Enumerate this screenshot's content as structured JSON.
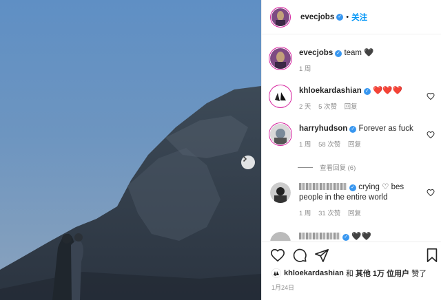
{
  "post": {
    "author": "evecjobs",
    "dot": "•",
    "follow_label": "关注",
    "caption": "team 🖤",
    "caption_time": "1 周"
  },
  "comments": [
    {
      "user": "khloekardashian",
      "text": "❤️❤️❤️",
      "time": "2 天",
      "likes": "5 次赞",
      "reply": "回复"
    },
    {
      "user": "harryhudson",
      "text": "Forever as fuck",
      "time": "1 周",
      "likes": "58 次赞",
      "reply": "回复"
    },
    {
      "user_hidden": "",
      "text_a": "crying ♡ bes",
      "text_b": "people in the entire world",
      "time": "1 周",
      "likes": "31 次赞",
      "reply": "回复"
    },
    {
      "text": "🖤🖤"
    }
  ],
  "view_replies": "查看回复 (6)",
  "likes_summary": {
    "user": "khloekardashian",
    "and": "和",
    "others": "其他 1万 位用户",
    "liked": "赞了"
  },
  "date": "1月24日",
  "icons": [
    "heart-icon",
    "comment-icon",
    "share-icon",
    "bookmark-icon",
    "next-arrow-icon",
    "verified-icon"
  ],
  "colors": {
    "verified": "#3897f0",
    "follow": "#0095f6",
    "heart_red": "#ed1c24",
    "ring": "#d6249f"
  }
}
